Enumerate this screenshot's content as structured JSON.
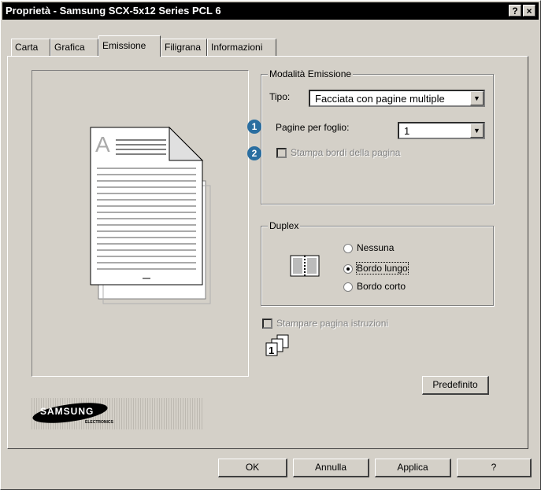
{
  "window": {
    "title": "Proprietà - Samsung SCX-5x12 Series PCL 6",
    "help_btn": "?",
    "close_btn": "×"
  },
  "tabs": [
    {
      "label": "Carta"
    },
    {
      "label": "Grafica"
    },
    {
      "label": "Emissione"
    },
    {
      "label": "Filigrana"
    },
    {
      "label": "Informazioni"
    }
  ],
  "preview": {
    "page_letter": "A"
  },
  "output_mode": {
    "group_label": "Modalità Emissione",
    "type_label": "Tipo:",
    "type_value": "Facciata con pagine multiple",
    "pages_label": "Pagine per foglio:",
    "pages_value": "1",
    "borders_label": "Stampa bordi della pagina",
    "badge1": "1",
    "badge2": "2"
  },
  "duplex": {
    "group_label": "Duplex",
    "options": [
      "Nessuna",
      "Bordo lungo",
      "Bordo corto"
    ],
    "selected": "Bordo lungo"
  },
  "instructions_label": "Stampare pagina istruzioni",
  "default_button": "Predefinito",
  "logo": {
    "brand": "SAMSUNG",
    "sub": "ELECTRONICS"
  },
  "footer": {
    "ok": "OK",
    "cancel": "Annulla",
    "apply": "Applica",
    "help": "?"
  },
  "colors": {
    "title_bg": "#000000",
    "face": "#d4d0c8",
    "badge": "#2a6ea0"
  }
}
